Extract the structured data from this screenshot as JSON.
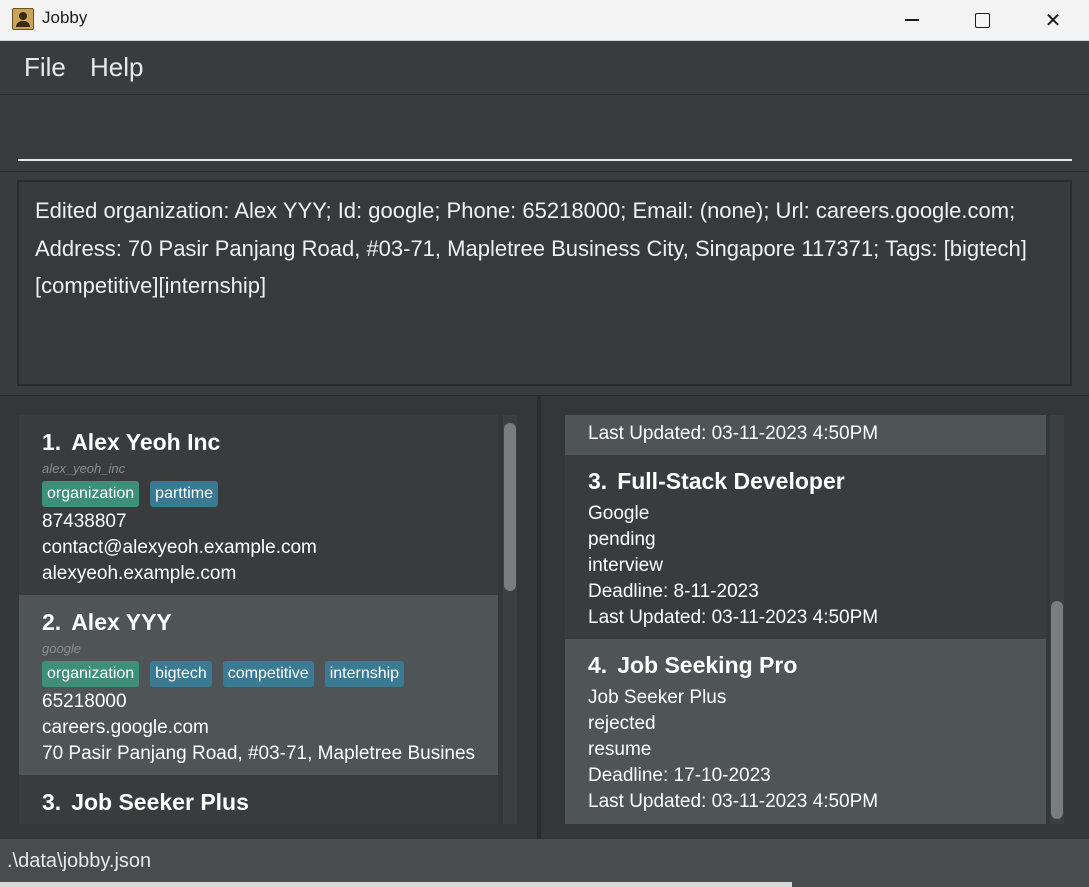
{
  "window": {
    "title": "Jobby",
    "minimize_icon": "minimize-icon",
    "maximize_icon": "maximize-icon",
    "close_icon": "close-icon"
  },
  "menu": {
    "file": "File",
    "help": "Help"
  },
  "command": {
    "value": "",
    "placeholder": ""
  },
  "result": {
    "text": "Edited organization: Alex YYY; Id: google; Phone: 65218000; Email: (none); Url: careers.google.com; Address: 70 Pasir Panjang Road, #03-71, Mapletree Business City, Singapore 117371; Tags: [bigtech][competitive][internship]"
  },
  "organizations": [
    {
      "index": "1.",
      "name": "Alex Yeoh Inc",
      "id": "alex_yeoh_inc",
      "tags": [
        "organization",
        "parttime"
      ],
      "phone": "87438807",
      "email": "contact@alexyeoh.example.com",
      "url": "alexyeoh.example.com"
    },
    {
      "index": "2.",
      "name": "Alex YYY",
      "id": "google",
      "tags": [
        "organization",
        "bigtech",
        "competitive",
        "internship"
      ],
      "phone": "65218000",
      "url": "careers.google.com",
      "address": "70 Pasir Panjang Road, #03-71, Mapletree Busines..."
    },
    {
      "index": "3.",
      "name": "Job Seeker Plus"
    }
  ],
  "jobs": {
    "partial_prev": {
      "last_updated": "Last Updated: 03-11-2023 4:50PM"
    },
    "items": [
      {
        "index": "3.",
        "title": "Full-Stack Developer",
        "org": "Google",
        "status": "pending",
        "stage": "interview",
        "deadline": "Deadline: 8-11-2023",
        "last_updated": "Last Updated: 03-11-2023 4:50PM"
      },
      {
        "index": "4.",
        "title": "Job Seeking Pro",
        "org": "Job Seeker Plus",
        "status": "rejected",
        "stage": "resume",
        "deadline": "Deadline: 17-10-2023",
        "last_updated": "Last Updated: 03-11-2023 4:50PM"
      }
    ]
  },
  "status": {
    "path": ".\\data\\jobby.json"
  },
  "colors": {
    "organization_tag": "#3e8f7a",
    "other_tag": "#3b7a93",
    "selected_card": "#4f5457"
  }
}
